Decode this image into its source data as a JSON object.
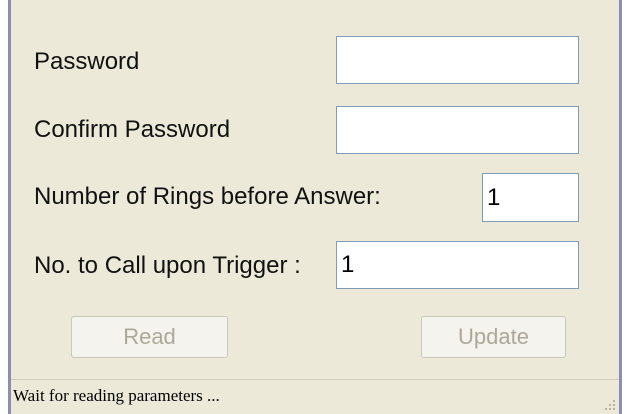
{
  "form": {
    "password": {
      "label": "Password",
      "value": ""
    },
    "confirm_password": {
      "label": "Confirm Password",
      "value": ""
    },
    "rings_before_answer": {
      "label": "Number of Rings before Answer:",
      "value": "1"
    },
    "call_upon_trigger": {
      "label": "No. to Call upon Trigger :",
      "value": "1"
    }
  },
  "buttons": {
    "read_label": "Read",
    "update_label": "Update"
  },
  "status": {
    "text": "Wait for reading parameters ..."
  },
  "icons": {
    "resize_grip": "resize-grip-icon"
  },
  "colors": {
    "window_background": "#ece9d8",
    "window_border": "#8a8fb0",
    "field_border": "#7f9db9",
    "disabled_text": "#aca899"
  }
}
